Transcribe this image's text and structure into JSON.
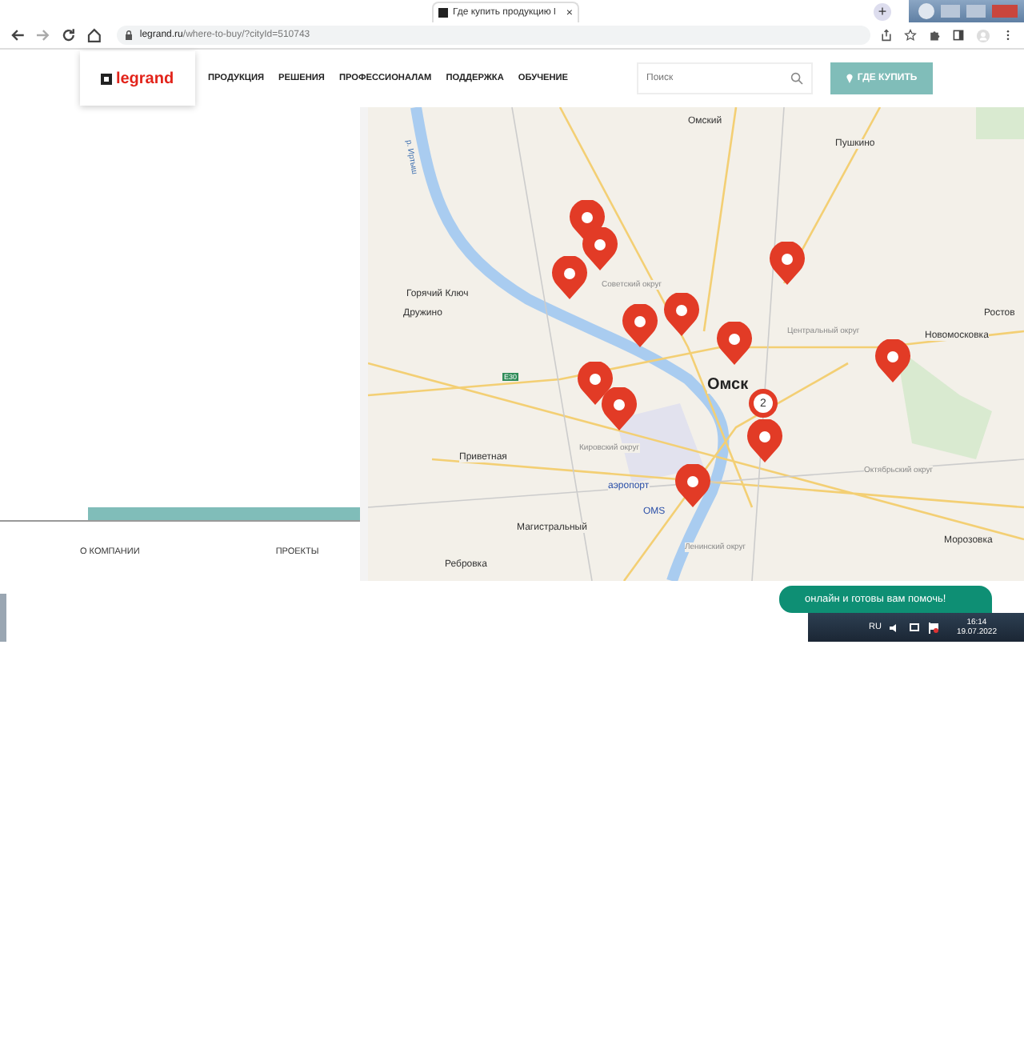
{
  "browser": {
    "tab": {
      "title": "Где купить продукцию l",
      "close": "×"
    },
    "new_tab": "+",
    "address": {
      "domain": "legrand.ru",
      "path": "/where-to-buy/?cityId=510743"
    }
  },
  "header": {
    "logo": "legrand",
    "nav": [
      "ПРОДУКЦИЯ",
      "РЕШЕНИЯ",
      "ПРОФЕССИОНАЛАМ",
      "ПОДДЕРЖКА",
      "ОБУЧЕНИЕ"
    ],
    "search": {
      "placeholder": "Поиск"
    },
    "cta": "ГДЕ КУПИТЬ"
  },
  "map": {
    "places": [
      {
        "label": "Омский",
        "kind": "town"
      },
      {
        "label": "Пушкино",
        "kind": "town"
      },
      {
        "label": "р. Иртыш",
        "kind": "river"
      },
      {
        "label": "Горячий Ключ",
        "kind": "town"
      },
      {
        "label": "Дружино",
        "kind": "town"
      },
      {
        "label": "Советский округ",
        "kind": "district"
      },
      {
        "label": "Ростов",
        "kind": "town"
      },
      {
        "label": "Центральный округ",
        "kind": "district"
      },
      {
        "label": "Новомосковка",
        "kind": "town"
      },
      {
        "label": "E30",
        "kind": "shield"
      },
      {
        "label": "Омск",
        "kind": "city"
      },
      {
        "label": "Кировский округ",
        "kind": "district"
      },
      {
        "label": "Приветная",
        "kind": "town"
      },
      {
        "label": "Октябрьский округ",
        "kind": "district"
      },
      {
        "label": "аэропорт",
        "kind": "airport"
      },
      {
        "label": "OMS",
        "kind": "airport"
      },
      {
        "label": "Магистральный",
        "kind": "town"
      },
      {
        "label": "Ленинский округ",
        "kind": "district"
      },
      {
        "label": "Морозовка",
        "kind": "town"
      },
      {
        "label": "Ребровка",
        "kind": "town"
      }
    ],
    "cluster": "2"
  },
  "footer_links": [
    "О КОМПАНИИ",
    "ПРОЕКТЫ"
  ],
  "chat": {
    "text": "онлайн и готовы вам помочь!"
  },
  "taskbar": {
    "language": "RU",
    "time": "16:14",
    "date": "19.07.2022"
  }
}
